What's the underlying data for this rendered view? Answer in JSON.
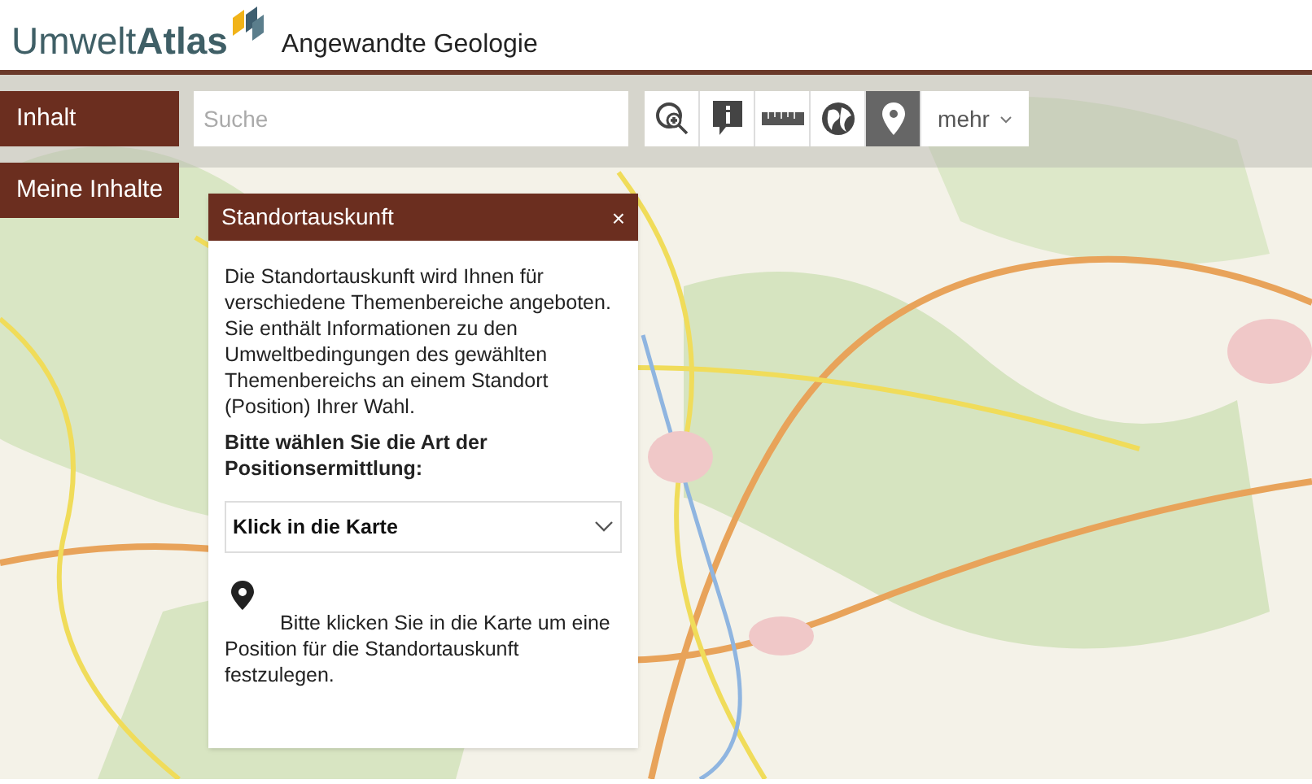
{
  "header": {
    "logo": {
      "light": "Umwelt",
      "bold": "Atlas"
    },
    "subtitle": "Angewandte Geologie"
  },
  "nav_buttons": [
    "Inhalt",
    "Meine Inhalte"
  ],
  "search": {
    "placeholder": "Suche"
  },
  "toolbar": {
    "tools": [
      {
        "kind": "zoom",
        "selected": false
      },
      {
        "kind": "info",
        "selected": false
      },
      {
        "kind": "ruler",
        "selected": false
      },
      {
        "kind": "globe",
        "selected": false
      },
      {
        "kind": "pin",
        "selected": true
      }
    ],
    "more": "mehr"
  },
  "panel": {
    "title": "Standortauskunft",
    "close": "×",
    "intro": "Die Standortauskunft wird Ihnen für verschiedene Themenbereiche angeboten. Sie enthält Informationen zu den Umweltbedingungen des gewählten Themenbereichs an einem Standort (Position) Ihrer Wahl.",
    "prompt": "Bitte wählen Sie die Art der Positionsermittlung:",
    "select": {
      "value": "Klick in die Karte"
    },
    "hint": "Bitte klicken Sie in die Karte um eine Position für die Standortauskunft festzulegen."
  }
}
